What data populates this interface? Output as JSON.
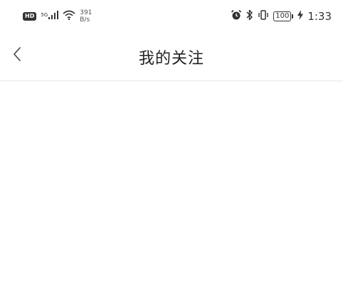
{
  "status_bar": {
    "hd_label": "HD",
    "network_label": "5G",
    "speed_value": "391",
    "speed_unit": "B/s",
    "battery_level": "100",
    "time": "1:33"
  },
  "nav": {
    "title": "我的关注"
  },
  "icons": {
    "back": "chevron-left-icon",
    "signal": "signal-bars-icon",
    "wifi": "wifi-icon",
    "alarm": "alarm-icon",
    "bluetooth": "bluetooth-icon",
    "vibrate": "vibrate-icon",
    "charging": "charging-bolt-icon"
  }
}
